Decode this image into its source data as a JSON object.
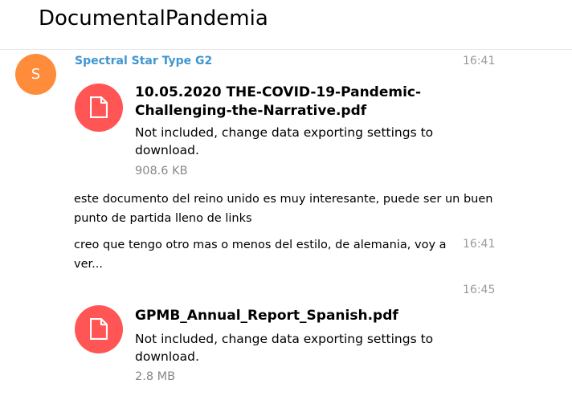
{
  "header": {
    "title": "DocumentalPandemia"
  },
  "message_group": {
    "avatar_letter": "S",
    "avatar_color": "#ff8c3b",
    "sender": "Spectral Star Type G2",
    "time": "16:41",
    "file1": {
      "name_line1": "10.05.2020 THE-COVID-19-Pandemic-",
      "name_line2": "Challenging-the-Narrative.pdf",
      "note_line1": "Not included, change data exporting settings to",
      "note_line2": "download.",
      "size": "908.6 KB"
    },
    "text1_line1": "este documento del reino unido es muy interesante, puede ser un buen",
    "text1_line2": "punto de partida lleno de links",
    "text2_line1": "creo que tengo otro mas o menos del estilo, de alemania, voy a",
    "text2_line2": "ver...",
    "text2_time": "16:41",
    "file2_time": "16:45",
    "file2": {
      "name": "GPMB_Annual_Report_Spanish.pdf",
      "note_line1": "Not included, change data exporting settings to",
      "note_line2": "download.",
      "size": "2.8 MB"
    }
  },
  "colors": {
    "accent": "#3f96d0",
    "file_icon": "#ff5555",
    "muted": "#999999"
  }
}
